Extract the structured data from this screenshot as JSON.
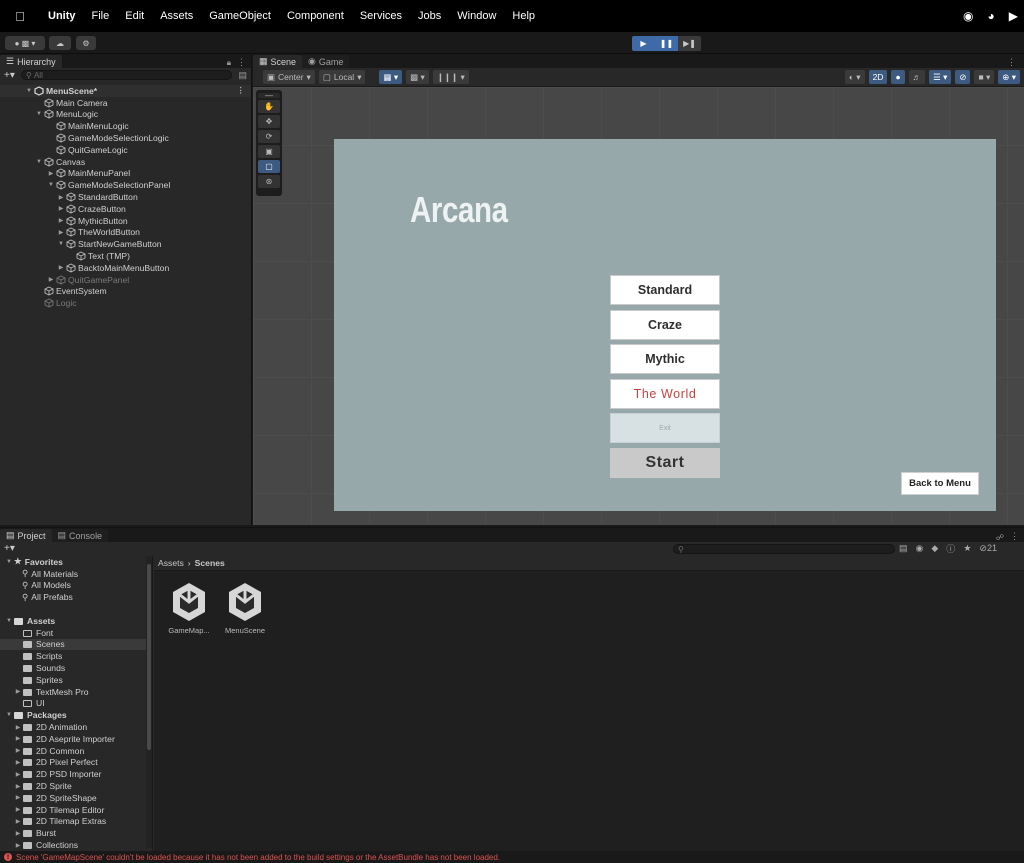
{
  "menubar": {
    "app": "Unity",
    "items": [
      "File",
      "Edit",
      "Assets",
      "GameObject",
      "Component",
      "Services",
      "Jobs",
      "Window",
      "Help"
    ]
  },
  "hierarchy": {
    "tab": "Hierarchy",
    "search_placeholder": "All",
    "scene": "MenuScene*",
    "nodes": [
      {
        "label": "Main Camera"
      },
      {
        "label": "MenuLogic"
      },
      {
        "label": "MainMenuLogic"
      },
      {
        "label": "GameModeSelectionLogic"
      },
      {
        "label": "QuitGameLogic"
      },
      {
        "label": "Canvas"
      },
      {
        "label": "MainMenuPanel"
      },
      {
        "label": "GameModeSelectionPanel"
      },
      {
        "label": "StandardButton"
      },
      {
        "label": "CrazeButton"
      },
      {
        "label": "MythicButton"
      },
      {
        "label": "TheWorldButton"
      },
      {
        "label": "StartNewGameButton"
      },
      {
        "label": "Text (TMP)"
      },
      {
        "label": "BacktoMainMenuButton"
      },
      {
        "label": "QuitGamePanel"
      },
      {
        "label": "EventSystem"
      },
      {
        "label": "Logic"
      }
    ]
  },
  "scene_view": {
    "tabs": [
      "Scene",
      "Game"
    ],
    "pivot": "Center",
    "space": "Local",
    "mode_2d": "2D"
  },
  "game": {
    "title": "Arcana",
    "buttons": [
      "Standard",
      "Craze",
      "Mythic",
      "The World",
      "Exit",
      "Start"
    ],
    "back_button": "Back to Menu"
  },
  "project": {
    "tabs": [
      "Project",
      "Console"
    ],
    "hidden_count": "21",
    "favorites_label": "Favorites",
    "favorites": [
      "All Materials",
      "All Models",
      "All Prefabs"
    ],
    "assets_label": "Assets",
    "asset_folders": [
      "Font",
      "Scenes",
      "Scripts",
      "Sounds",
      "Sprites",
      "TextMesh Pro",
      "UI"
    ],
    "packages_label": "Packages",
    "packages": [
      "2D Animation",
      "2D Aseprite Importer",
      "2D Common",
      "2D Pixel Perfect",
      "2D PSD Importer",
      "2D Sprite",
      "2D SpriteShape",
      "2D Tilemap Editor",
      "2D Tilemap Extras",
      "Burst",
      "Collections"
    ],
    "breadcrumb": [
      "Assets",
      "Scenes"
    ],
    "assets": [
      "GameMap...",
      "MenuScene"
    ]
  },
  "status": {
    "message": "Scene 'GameMapScene' couldn't be loaded because it has not been added to the build settings or the AssetBundle has not been loaded."
  }
}
